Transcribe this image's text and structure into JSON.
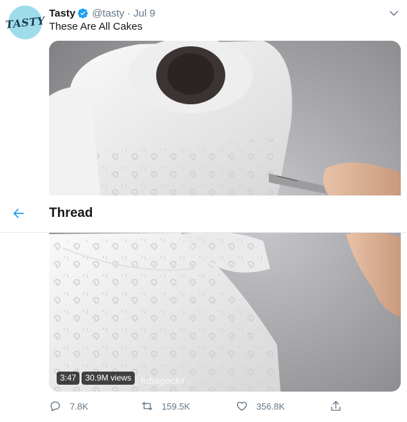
{
  "tweet": {
    "avatar_text": "TASTY",
    "display_name": "Tasty",
    "handle": "@tasty",
    "separator": "·",
    "date": "Jul 9",
    "text": "These Are All Cakes",
    "media": {
      "duration": "3:47",
      "views": "30.9M views",
      "watermark": "_tubageckil"
    },
    "actions": {
      "replies": "7.8K",
      "retweets": "159.5K",
      "likes": "356.8K"
    }
  },
  "thread_bar": {
    "title": "Thread"
  },
  "colors": {
    "accent": "#1da1f2",
    "verified": "#1da1f2",
    "muted": "#657786",
    "avatar_bg": "#9fdcea"
  },
  "icons": {
    "verified": "verified-badge-icon",
    "caret": "chevron-down-icon",
    "back": "arrow-left-icon",
    "reply": "reply-icon",
    "retweet": "retweet-icon",
    "like": "heart-icon",
    "share": "share-icon"
  }
}
